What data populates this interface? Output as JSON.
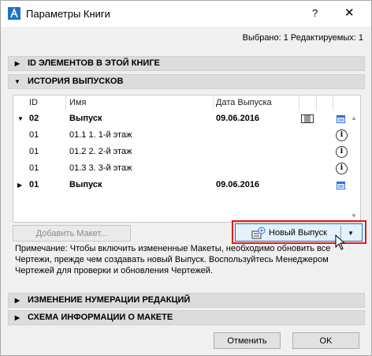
{
  "window": {
    "title": "Параметры Книги",
    "help_label": "?",
    "close_label": "✕"
  },
  "selection_info": "Выбрано: 1 Редактируемых: 1",
  "sections": {
    "id_elements": "ID ЭЛЕМЕНТОВ В ЭТОЙ КНИГЕ",
    "history": "ИСТОРИЯ ВЫПУСКОВ",
    "renumbering": "ИЗМЕНЕНИЕ НУМЕРАЦИИ РЕДАКЦИЙ",
    "layout_info": "СХЕМА ИНФОРМАЦИИ О МАКЕТЕ"
  },
  "table": {
    "headers": [
      "ID",
      "Имя",
      "Дата Выпуска"
    ],
    "rows": [
      {
        "id": "02",
        "name": "Выпуск",
        "date": "09.06.2016"
      },
      {
        "id": "01",
        "name": "01.1 1. 1-й этаж",
        "date": ""
      },
      {
        "id": "01",
        "name": "01.2 2. 2-й этаж",
        "date": ""
      },
      {
        "id": "01",
        "name": "01.3 3. 3-й этаж",
        "date": ""
      },
      {
        "id": "01",
        "name": "Выпуск",
        "date": "09.06.2016"
      }
    ]
  },
  "buttons": {
    "add_layout": "Добавить Макет...",
    "new_issue": "Новый Выпуск",
    "cancel": "Отменить",
    "ok": "OK"
  },
  "note": "Примечание: Чтобы включить измененные Макеты, необходимо обновить все Чертежи, прежде чем создавать новый Выпуск. Воспользуйтесь Менеджером Чертежей для проверки и обновления Чертежей.",
  "colors": {
    "highlight": "#e11b1b",
    "accent_icon": "#2e6fd6"
  }
}
